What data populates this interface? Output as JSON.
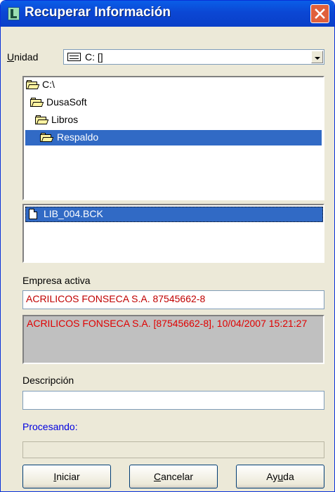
{
  "window": {
    "title": "Recuperar Información"
  },
  "unidad": {
    "label_u": "U",
    "label_rest": "nidad",
    "value": "C: []"
  },
  "directories": [
    {
      "label": "C:\\"
    },
    {
      "label": "DusaSoft"
    },
    {
      "label": "Libros"
    },
    {
      "label": "Respaldo"
    }
  ],
  "files": [
    {
      "label": "LIB_004.BCK"
    }
  ],
  "empresa": {
    "label": "Empresa activa",
    "value": "ACRILICOS FONSECA S.A. 87545662-8"
  },
  "backup_info": "ACRILICOS FONSECA S.A. [87545662-8], 10/04/2007 15:21:27",
  "descripcion": {
    "label": "Descripción",
    "value": ""
  },
  "status": {
    "label": "Procesando:",
    "progress": 0
  },
  "buttons": {
    "iniciar_u": "I",
    "iniciar_rest": "niciar",
    "cancelar_u": "C",
    "cancelar_rest": "ancelar",
    "ayuda_pre": "Ay",
    "ayuda_u": "u",
    "ayuda_rest": "da"
  },
  "colors": {
    "title_bar": "#0b47d4",
    "selection": "#316ac5",
    "red_text": "#c00000",
    "blue_text": "#0000e0"
  }
}
